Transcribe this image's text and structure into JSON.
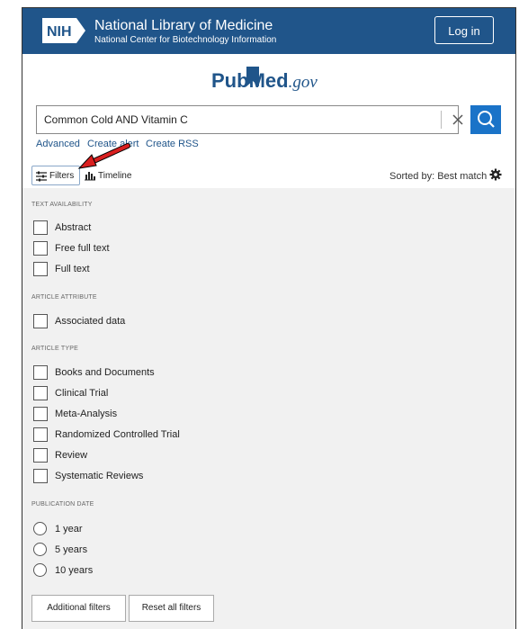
{
  "header": {
    "nih_logo_text": "NIH",
    "title": "National Library of Medicine",
    "subtitle": "National Center for Biotechnology Information",
    "login_label": "Log in"
  },
  "logo": {
    "pub": "Pub",
    "med": "Med",
    "gov": ".gov"
  },
  "search": {
    "value": "Common Cold AND Vitamin C"
  },
  "links": {
    "advanced": "Advanced",
    "create_alert": "Create alert",
    "create_rss": "Create RSS"
  },
  "tools": {
    "filters_label": "Filters",
    "timeline_label": "Timeline",
    "sorted_label": "Sorted by: Best match"
  },
  "filters": {
    "text_availability": {
      "title": "TEXT AVAILABILITY",
      "items": [
        "Abstract",
        "Free full text",
        "Full text"
      ]
    },
    "article_attribute": {
      "title": "ARTICLE ATTRIBUTE",
      "items": [
        "Associated data"
      ]
    },
    "article_type": {
      "title": "ARTICLE TYPE",
      "items": [
        "Books and Documents",
        "Clinical Trial",
        "Meta-Analysis",
        "Randomized Controlled Trial",
        "Review",
        "Systematic Reviews"
      ]
    },
    "publication_date": {
      "title": "PUBLICATION DATE",
      "items": [
        "1 year",
        "5 years",
        "10 years"
      ]
    }
  },
  "buttons": {
    "additional_filters": "Additional filters",
    "reset_all": "Reset all filters"
  },
  "colors": {
    "header_bg": "#20558a",
    "search_btn": "#1a73c8",
    "annotation_arrow": "#d91f1f",
    "panel_bg": "#f1f1f1"
  }
}
